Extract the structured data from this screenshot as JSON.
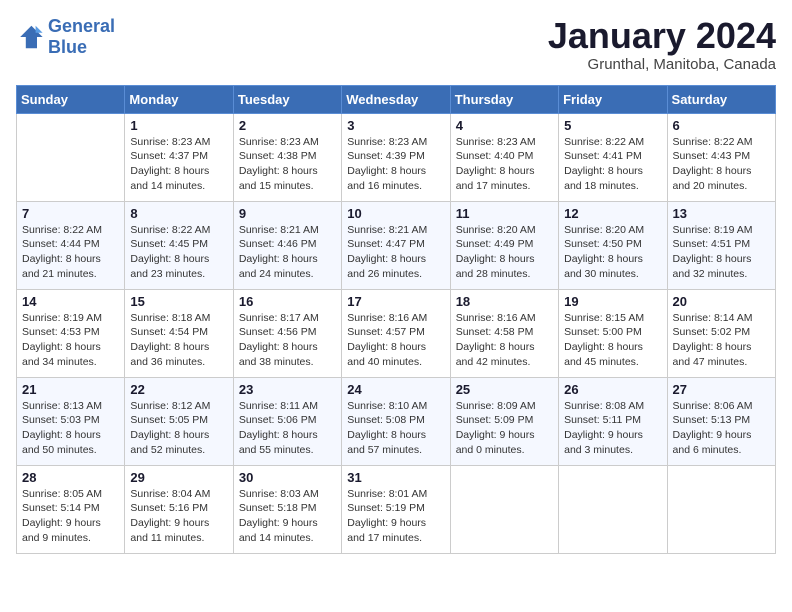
{
  "header": {
    "logo_line1": "General",
    "logo_line2": "Blue",
    "month": "January 2024",
    "location": "Grunthal, Manitoba, Canada"
  },
  "days_of_week": [
    "Sunday",
    "Monday",
    "Tuesday",
    "Wednesday",
    "Thursday",
    "Friday",
    "Saturday"
  ],
  "weeks": [
    [
      {
        "day": "",
        "info": ""
      },
      {
        "day": "1",
        "info": "Sunrise: 8:23 AM\nSunset: 4:37 PM\nDaylight: 8 hours\nand 14 minutes."
      },
      {
        "day": "2",
        "info": "Sunrise: 8:23 AM\nSunset: 4:38 PM\nDaylight: 8 hours\nand 15 minutes."
      },
      {
        "day": "3",
        "info": "Sunrise: 8:23 AM\nSunset: 4:39 PM\nDaylight: 8 hours\nand 16 minutes."
      },
      {
        "day": "4",
        "info": "Sunrise: 8:23 AM\nSunset: 4:40 PM\nDaylight: 8 hours\nand 17 minutes."
      },
      {
        "day": "5",
        "info": "Sunrise: 8:22 AM\nSunset: 4:41 PM\nDaylight: 8 hours\nand 18 minutes."
      },
      {
        "day": "6",
        "info": "Sunrise: 8:22 AM\nSunset: 4:43 PM\nDaylight: 8 hours\nand 20 minutes."
      }
    ],
    [
      {
        "day": "7",
        "info": "Sunrise: 8:22 AM\nSunset: 4:44 PM\nDaylight: 8 hours\nand 21 minutes."
      },
      {
        "day": "8",
        "info": "Sunrise: 8:22 AM\nSunset: 4:45 PM\nDaylight: 8 hours\nand 23 minutes."
      },
      {
        "day": "9",
        "info": "Sunrise: 8:21 AM\nSunset: 4:46 PM\nDaylight: 8 hours\nand 24 minutes."
      },
      {
        "day": "10",
        "info": "Sunrise: 8:21 AM\nSunset: 4:47 PM\nDaylight: 8 hours\nand 26 minutes."
      },
      {
        "day": "11",
        "info": "Sunrise: 8:20 AM\nSunset: 4:49 PM\nDaylight: 8 hours\nand 28 minutes."
      },
      {
        "day": "12",
        "info": "Sunrise: 8:20 AM\nSunset: 4:50 PM\nDaylight: 8 hours\nand 30 minutes."
      },
      {
        "day": "13",
        "info": "Sunrise: 8:19 AM\nSunset: 4:51 PM\nDaylight: 8 hours\nand 32 minutes."
      }
    ],
    [
      {
        "day": "14",
        "info": "Sunrise: 8:19 AM\nSunset: 4:53 PM\nDaylight: 8 hours\nand 34 minutes."
      },
      {
        "day": "15",
        "info": "Sunrise: 8:18 AM\nSunset: 4:54 PM\nDaylight: 8 hours\nand 36 minutes."
      },
      {
        "day": "16",
        "info": "Sunrise: 8:17 AM\nSunset: 4:56 PM\nDaylight: 8 hours\nand 38 minutes."
      },
      {
        "day": "17",
        "info": "Sunrise: 8:16 AM\nSunset: 4:57 PM\nDaylight: 8 hours\nand 40 minutes."
      },
      {
        "day": "18",
        "info": "Sunrise: 8:16 AM\nSunset: 4:58 PM\nDaylight: 8 hours\nand 42 minutes."
      },
      {
        "day": "19",
        "info": "Sunrise: 8:15 AM\nSunset: 5:00 PM\nDaylight: 8 hours\nand 45 minutes."
      },
      {
        "day": "20",
        "info": "Sunrise: 8:14 AM\nSunset: 5:02 PM\nDaylight: 8 hours\nand 47 minutes."
      }
    ],
    [
      {
        "day": "21",
        "info": "Sunrise: 8:13 AM\nSunset: 5:03 PM\nDaylight: 8 hours\nand 50 minutes."
      },
      {
        "day": "22",
        "info": "Sunrise: 8:12 AM\nSunset: 5:05 PM\nDaylight: 8 hours\nand 52 minutes."
      },
      {
        "day": "23",
        "info": "Sunrise: 8:11 AM\nSunset: 5:06 PM\nDaylight: 8 hours\nand 55 minutes."
      },
      {
        "day": "24",
        "info": "Sunrise: 8:10 AM\nSunset: 5:08 PM\nDaylight: 8 hours\nand 57 minutes."
      },
      {
        "day": "25",
        "info": "Sunrise: 8:09 AM\nSunset: 5:09 PM\nDaylight: 9 hours\nand 0 minutes."
      },
      {
        "day": "26",
        "info": "Sunrise: 8:08 AM\nSunset: 5:11 PM\nDaylight: 9 hours\nand 3 minutes."
      },
      {
        "day": "27",
        "info": "Sunrise: 8:06 AM\nSunset: 5:13 PM\nDaylight: 9 hours\nand 6 minutes."
      }
    ],
    [
      {
        "day": "28",
        "info": "Sunrise: 8:05 AM\nSunset: 5:14 PM\nDaylight: 9 hours\nand 9 minutes."
      },
      {
        "day": "29",
        "info": "Sunrise: 8:04 AM\nSunset: 5:16 PM\nDaylight: 9 hours\nand 11 minutes."
      },
      {
        "day": "30",
        "info": "Sunrise: 8:03 AM\nSunset: 5:18 PM\nDaylight: 9 hours\nand 14 minutes."
      },
      {
        "day": "31",
        "info": "Sunrise: 8:01 AM\nSunset: 5:19 PM\nDaylight: 9 hours\nand 17 minutes."
      },
      {
        "day": "",
        "info": ""
      },
      {
        "day": "",
        "info": ""
      },
      {
        "day": "",
        "info": ""
      }
    ]
  ]
}
